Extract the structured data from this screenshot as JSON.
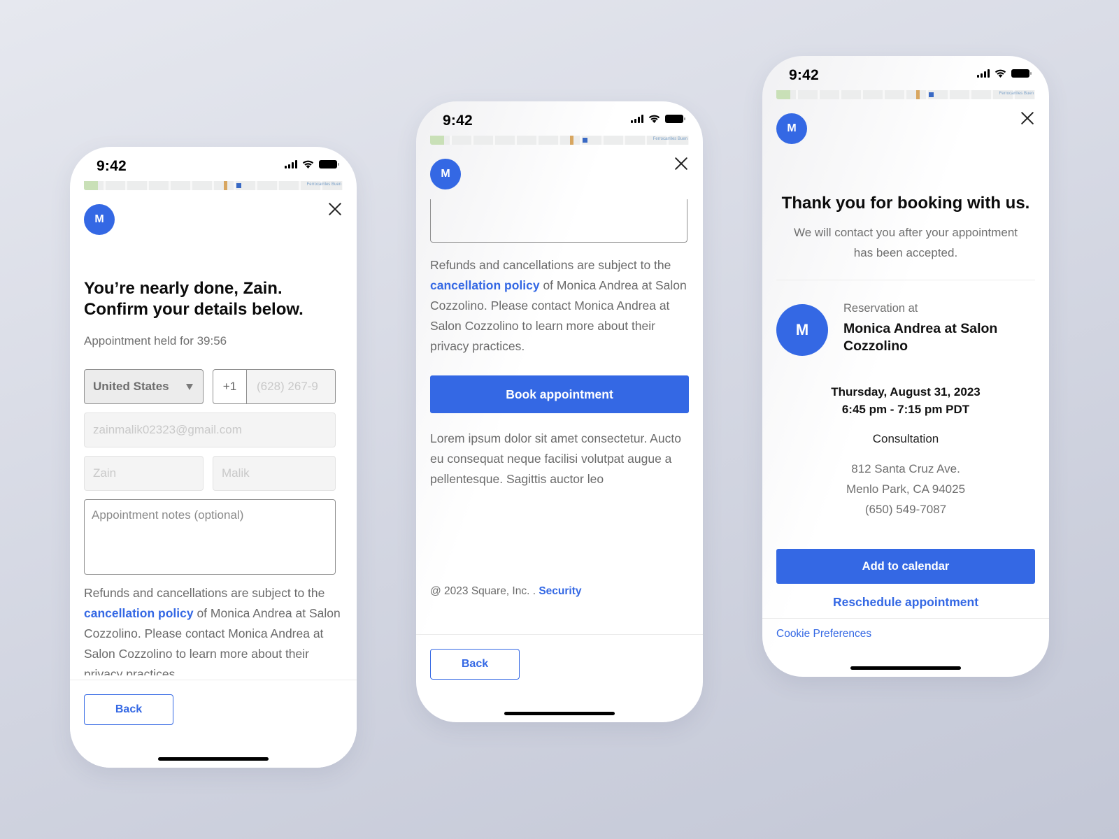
{
  "status_bar": {
    "time": "9:42"
  },
  "map": {
    "label": "Ferrocarriles Buen"
  },
  "avatar_initial": "M",
  "screen1": {
    "heading_line1": "You’re nearly done, Zain.",
    "heading_line2": "Confirm your details below.",
    "held_text": "Appointment held for 39:56",
    "country_select": {
      "value": "United States"
    },
    "phone_code": "+1",
    "phone_input": {
      "value": "(628) 267-9"
    },
    "email_input": {
      "value": "zainmalik02323@gmail.com"
    },
    "first_name_input": {
      "value": "Zain"
    },
    "last_name_input": {
      "value": "Malik"
    },
    "notes_input": {
      "placeholder": "Appointment notes (optional)"
    },
    "policy": {
      "prefix": "Refunds and cancellations are subject to the",
      "link": "cancellation policy",
      "suffix": " of Monica Andrea at Salon Cozzolino. Please contact Monica Andrea at Salon Cozzolino to learn more about their privacy practices."
    },
    "back_label": "Back"
  },
  "screen2": {
    "policy": {
      "prefix": "Refunds and cancellations are subject to the",
      "link": "cancellation policy",
      "suffix": " of Monica Andrea at Salon Cozzolino. Please contact Monica Andrea at Salon Cozzolino to learn more about their privacy practices."
    },
    "book_label": "Book appointment",
    "lorem": "Lorem ipsum dolor sit amet consectetur. Aucto eu consequat neque facilisi volutpat augue a pellentesque. Sagittis auctor leo",
    "copyright": "@ 2023 Square, Inc.  .",
    "security_link": "Security",
    "back_label": "Back"
  },
  "screen3": {
    "title": "Thank you for booking with us.",
    "subtitle": "We will contact you after your appointment has been accepted.",
    "reservation_label": "Reservation at",
    "business_name": "Monica Andrea at Salon Cozzolino",
    "date": "Thursday, August 31, 2023",
    "time_range": "6:45 pm - 7:15 pm PDT",
    "service": "Consultation",
    "address_line1": "812 Santa Cruz Ave.",
    "address_line2": "Menlo Park, CA 94025",
    "phone": "(650) 549-7087",
    "add_calendar_label": "Add to calendar",
    "reschedule_label": "Reschedule appointment",
    "cookie_label": "Cookie Preferences"
  },
  "colors": {
    "accent": "#3468e4"
  }
}
